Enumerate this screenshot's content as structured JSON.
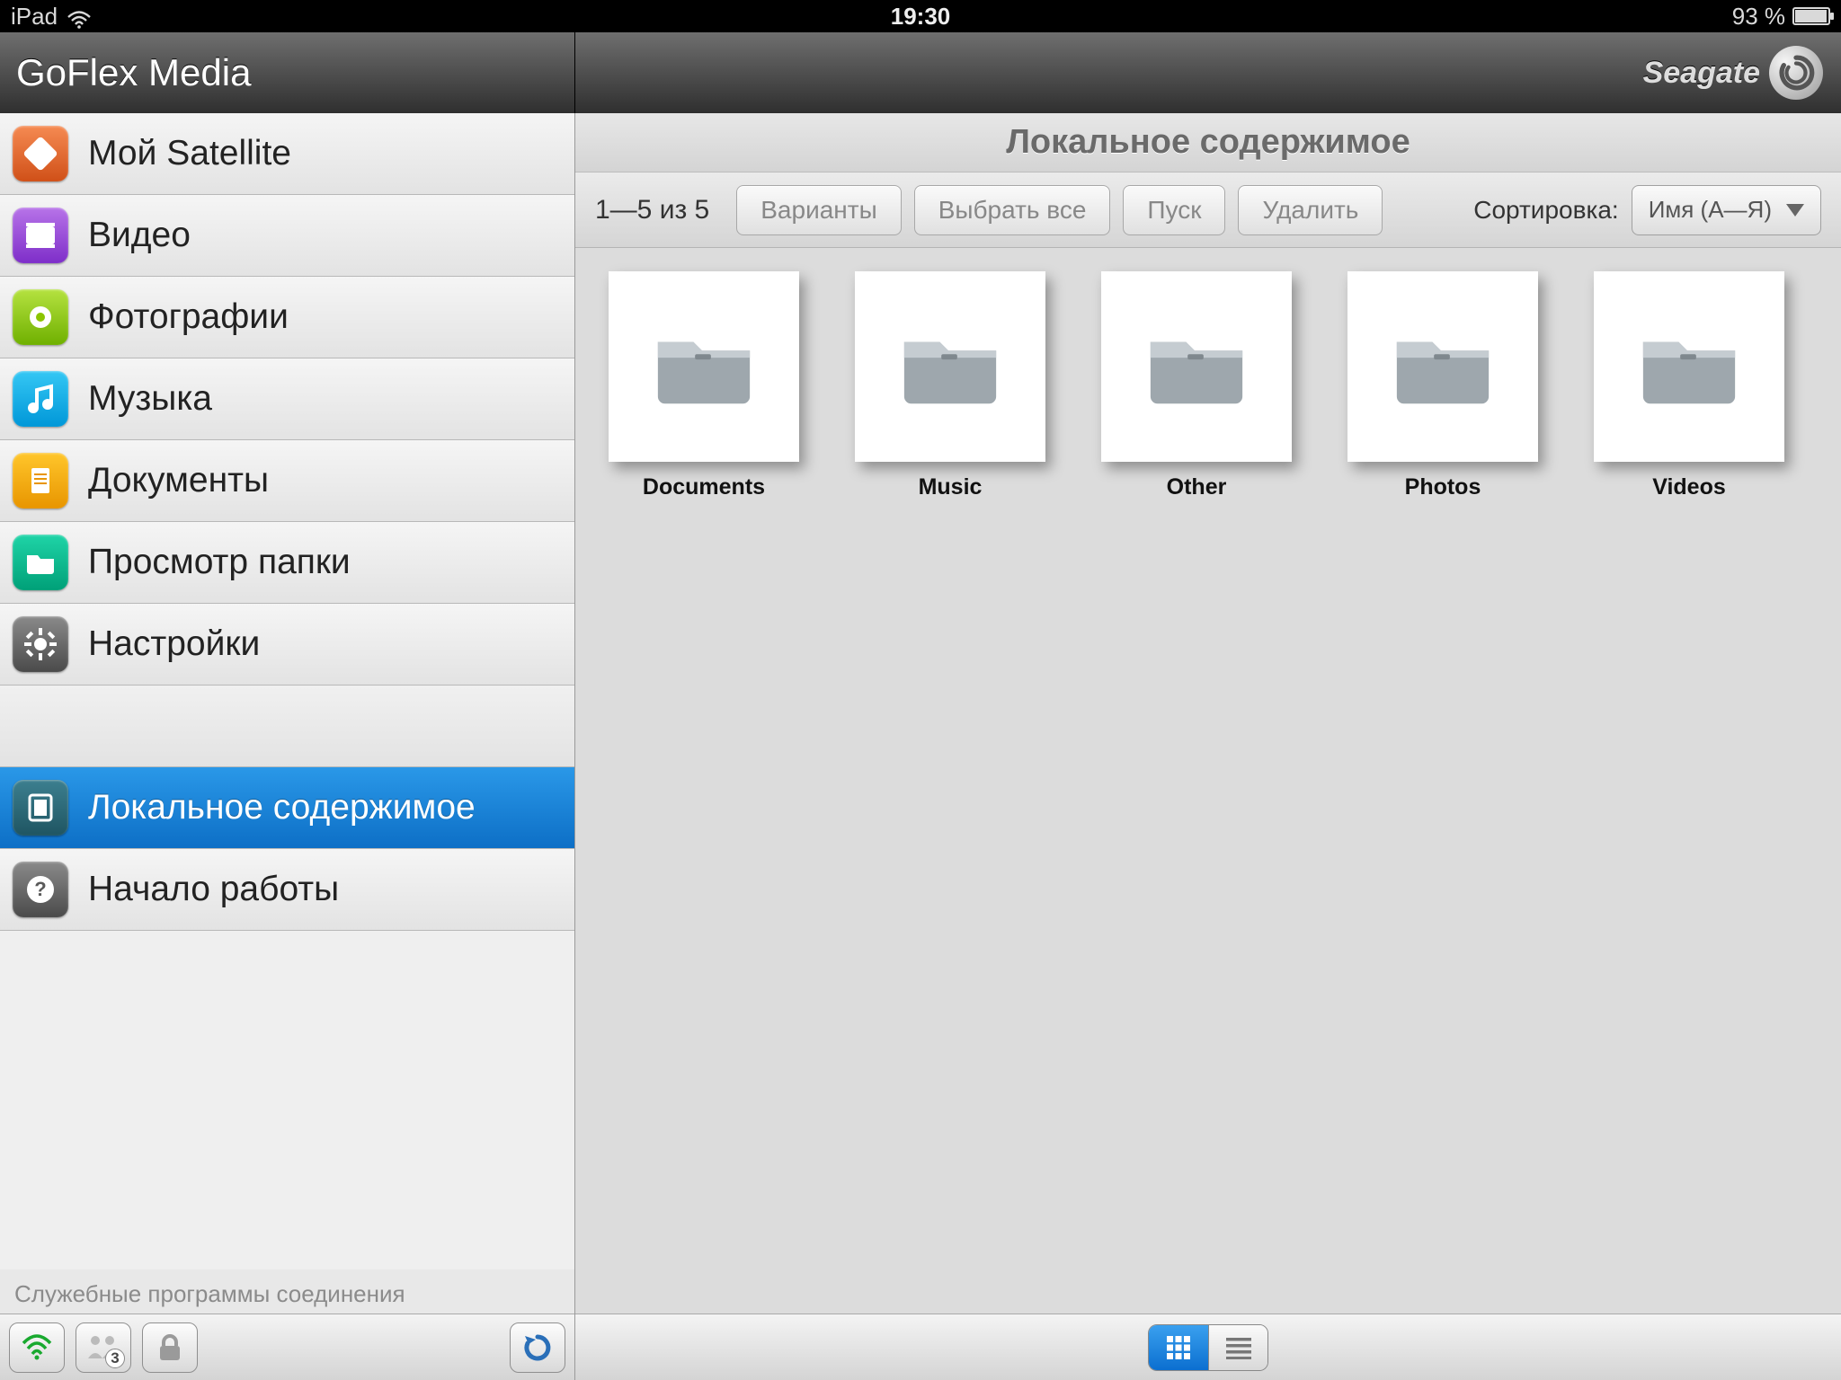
{
  "statusbar": {
    "device": "iPad",
    "time": "19:30",
    "battery": "93 %"
  },
  "header": {
    "app_title": "GoFlex Media",
    "brand": "Seagate"
  },
  "sidebar": {
    "items": [
      {
        "label": "Мой Satellite",
        "icon": "satellite-icon",
        "color1": "#f58a52",
        "color2": "#d05018"
      },
      {
        "label": "Видео",
        "icon": "video-icon",
        "color1": "#b773e8",
        "color2": "#7e2ec9"
      },
      {
        "label": "Фотографии",
        "icon": "photos-icon",
        "color1": "#b5e240",
        "color2": "#6fb000"
      },
      {
        "label": "Музыка",
        "icon": "music-icon",
        "color1": "#35c7f4",
        "color2": "#0097d8"
      },
      {
        "label": "Документы",
        "icon": "documents-icon",
        "color1": "#ffc62b",
        "color2": "#e89500"
      },
      {
        "label": "Просмотр папки",
        "icon": "folder-icon",
        "color1": "#1fd4a7",
        "color2": "#00a078"
      },
      {
        "label": "Настройки",
        "icon": "settings-icon",
        "color1": "#8a8a8a",
        "color2": "#4a4a4a"
      },
      {
        "label": "Локальное содержимое",
        "icon": "local-icon",
        "color1": "#3c7f8f",
        "color2": "#1f5562"
      },
      {
        "label": "Начало работы",
        "icon": "help-icon",
        "color1": "#8a8a8a",
        "color2": "#4a4a4a"
      }
    ],
    "connection_tools_label": "Служебные программы соединения",
    "badge_count": "3"
  },
  "content": {
    "title": "Локальное содержимое",
    "count_label": "1—5 из 5",
    "buttons": {
      "options": "Варианты",
      "select_all": "Выбрать все",
      "play": "Пуск",
      "delete": "Удалить"
    },
    "sort_label": "Сортировка:",
    "sort_value": "Имя (А—Я)",
    "folders": [
      {
        "name": "Documents"
      },
      {
        "name": "Music"
      },
      {
        "name": "Other"
      },
      {
        "name": "Photos"
      },
      {
        "name": "Videos"
      }
    ]
  }
}
